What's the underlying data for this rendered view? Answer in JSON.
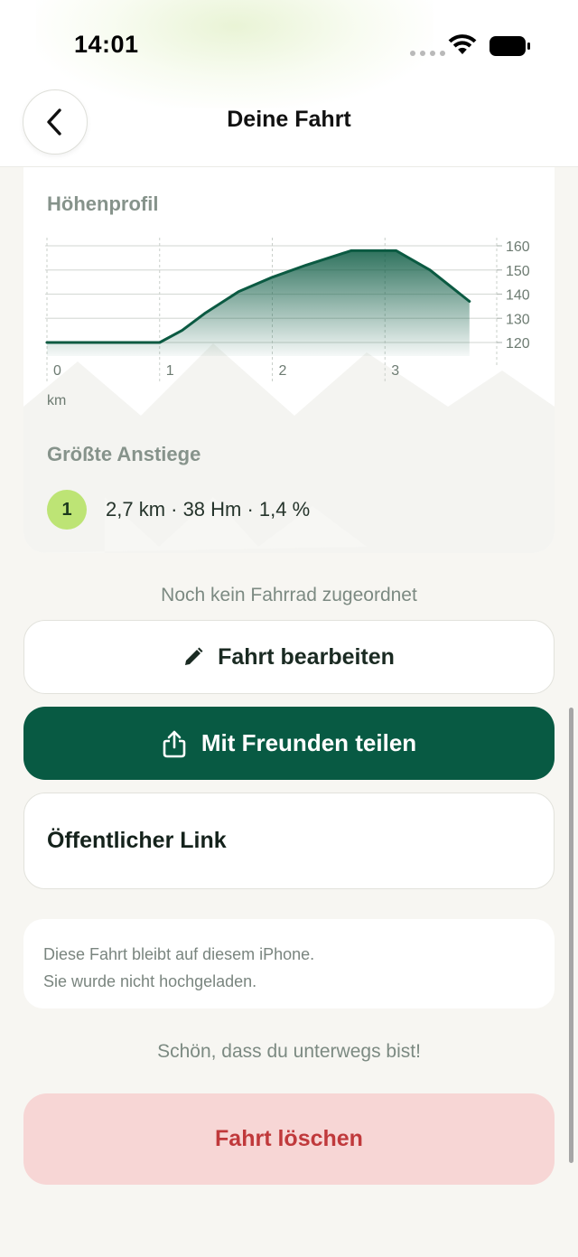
{
  "status_bar": {
    "time": "14:01"
  },
  "nav": {
    "title": "Deine Fahrt"
  },
  "profile": {
    "title": "Höhenprofil",
    "distance_unit": "km",
    "climbs_title": "Größte Anstiege",
    "climbs": [
      {
        "rank": "1",
        "summary": "2,7 km · 38 Hm · 1,4 %"
      }
    ]
  },
  "chart_data": {
    "type": "area",
    "x": [
      0,
      0.3,
      0.6,
      0.9,
      1.0,
      1.2,
      1.4,
      1.7,
      2.0,
      2.3,
      2.7,
      3.1,
      3.4,
      3.75
    ],
    "y": [
      120,
      120,
      120,
      120,
      120,
      125,
      132,
      141,
      147,
      152,
      158,
      158,
      150,
      137
    ],
    "x_ticks": [
      "0",
      "1",
      "2",
      "3"
    ],
    "y_ticks": [
      "120",
      "130",
      "140",
      "150",
      "160"
    ],
    "xlabel": "km",
    "xlim": [
      0,
      4
    ],
    "ylim": [
      115,
      163
    ],
    "grid": true,
    "colors": {
      "line": "#0b5a42",
      "fill": "#0b5a42"
    }
  },
  "bike_note": "Noch kein Fahrrad zugeordnet",
  "buttons": {
    "edit": "Fahrt bearbeiten",
    "share": "Mit Freunden teilen",
    "public_link": "Öffentlicher Link",
    "delete": "Fahrt löschen"
  },
  "privacy_info": {
    "line1": "Diese Fahrt bleibt auf diesem iPhone.",
    "line2": "Sie wurde nicht hochgeladen."
  },
  "farewell": "Schön, dass du unterwegs bist!",
  "colors": {
    "primary": "#085a43",
    "badge": "#bde475",
    "danger_bg": "#f7d6d5",
    "danger_text": "#c0393b"
  }
}
